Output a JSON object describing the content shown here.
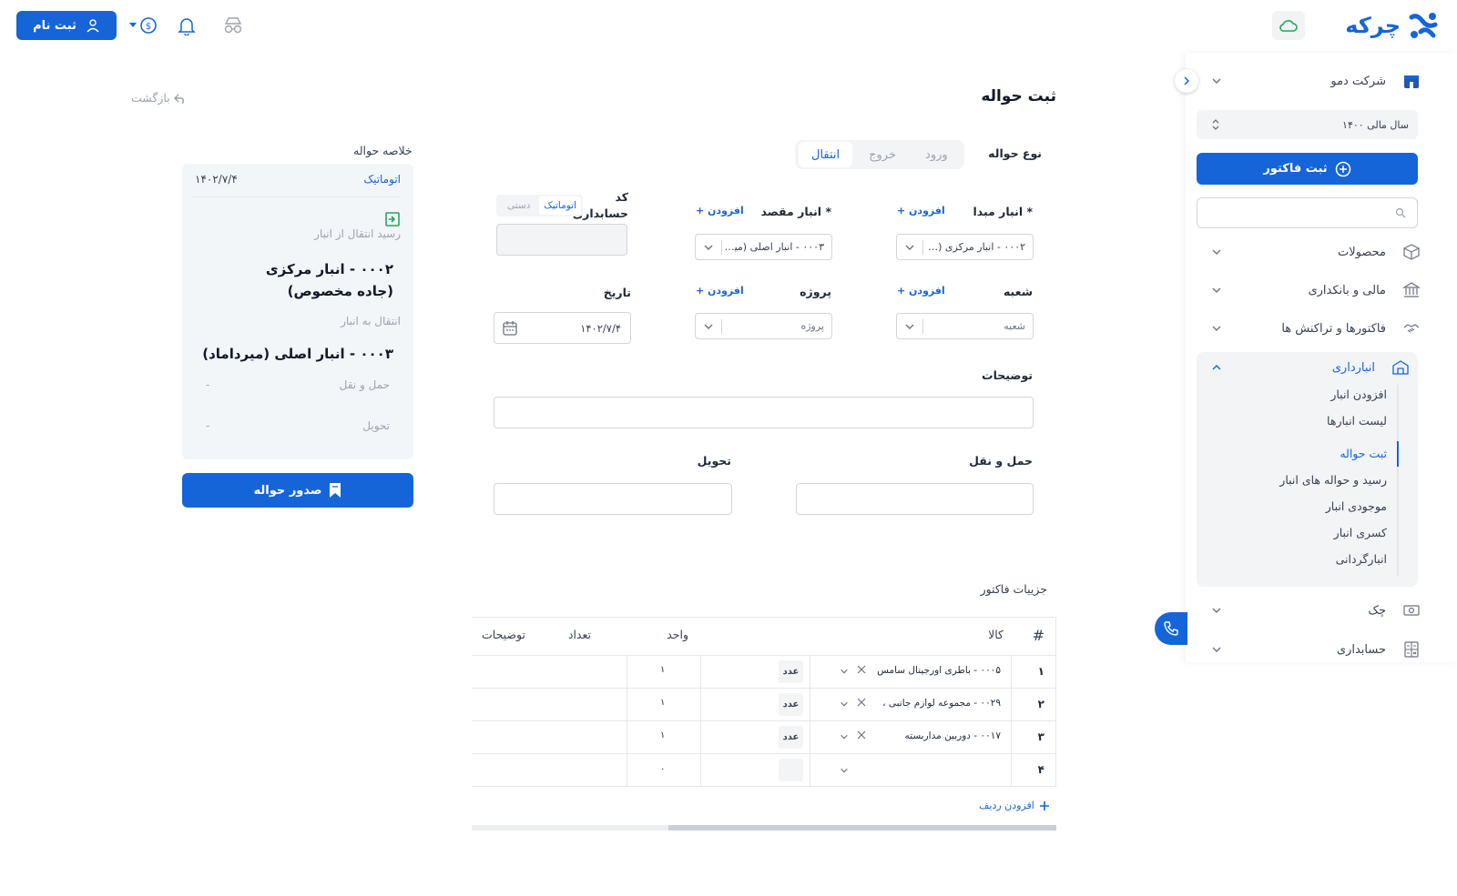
{
  "header": {
    "logo_text": "چرکه",
    "signup_label": "ثبت نام"
  },
  "sidebar": {
    "company": "شرکت دمو",
    "fiscal_year": "سال مالی ۱۴۰۰",
    "new_invoice_label": "ثبت فاکتور",
    "search_placeholder": "",
    "items": [
      {
        "label": "محصولات"
      },
      {
        "label": "مالی و بانکداری"
      },
      {
        "label": "فاکتورها و تراکنش ها"
      },
      {
        "label": "انبارداری"
      }
    ],
    "warehouse_submenu": [
      {
        "label": "افزودن انبار"
      },
      {
        "label": "لیست انبارها"
      },
      {
        "label": "ثبت حواله"
      },
      {
        "label": "رسید و حواله های انبار"
      },
      {
        "label": "موجودی انبار"
      },
      {
        "label": "کسری انبار"
      },
      {
        "label": "انبارگردانی"
      }
    ],
    "bottom_items": [
      {
        "label": "چک"
      },
      {
        "label": "حسابداری"
      }
    ]
  },
  "page": {
    "title": "ثبت حواله",
    "back_label": "بازگشت"
  },
  "form": {
    "type_label": "نوع حواله",
    "type_tabs": [
      {
        "label": "ورود"
      },
      {
        "label": "خروج"
      },
      {
        "label": "انتقال"
      }
    ],
    "source_label": "انبار مبدا *",
    "source_value": "۰۰۰۲ - انبار مرکزی (جاد...",
    "dest_label": "انبار مقصد *",
    "dest_value": "۰۰۰۳ - انبار اصلی (میر...",
    "add_label": "+ افزودن",
    "code_label_line1": "کد",
    "code_label_line2": "حسابداری",
    "code_mode_auto": "اتوماتیک",
    "code_mode_manual": "دستی",
    "branch_label": "شعبه",
    "branch_placeholder": "شعبه",
    "project_label": "پروژه",
    "project_placeholder": "پروژه",
    "date_label": "تاریخ",
    "date_value": "۱۴۰۲/۷/۴",
    "notes_label": "توضیحات",
    "shipping_label": "حمل و نقل",
    "delivery_label": "تحویل"
  },
  "details": {
    "title": "جزییات فاکتور",
    "headers": {
      "num": "#",
      "item": "کالا",
      "unit": "واحد",
      "qty": "تعداد",
      "notes": "توضیحات"
    },
    "rows": [
      {
        "num": "۱",
        "item": "۰۰۰۵ - باطری اورجینال سامس",
        "unit": "عدد",
        "qty": "۱"
      },
      {
        "num": "۲",
        "item": "۰۰۲۹ - مجموعه لوازم جانبی ،",
        "unit": "عدد",
        "qty": "۱"
      },
      {
        "num": "۳",
        "item": "۰۰۱۷ - دوربین مداربسته",
        "unit": "عدد",
        "qty": "۱"
      },
      {
        "num": "۴",
        "item": "",
        "unit": "",
        "qty": "۰"
      }
    ],
    "add_row_label": "افزودن ردیف"
  },
  "summary": {
    "title": "خلاصه حواله",
    "mode": "اتوماتیک",
    "date": "۱۴۰۲/۷/۴",
    "from_label": "رسید انتقال از انبار",
    "from_value": "۰۰۰۲ - انبار مرکزی (جاده مخصوص)",
    "to_label": "انتقال به انبار",
    "to_value": "۰۰۰۳ - انبار اصلی (میرداماد)",
    "shipping_label": "حمل و نقل",
    "shipping_value": "-",
    "delivery_label": "تحویل",
    "delivery_value": "-",
    "issue_label": "صدور حواله"
  }
}
